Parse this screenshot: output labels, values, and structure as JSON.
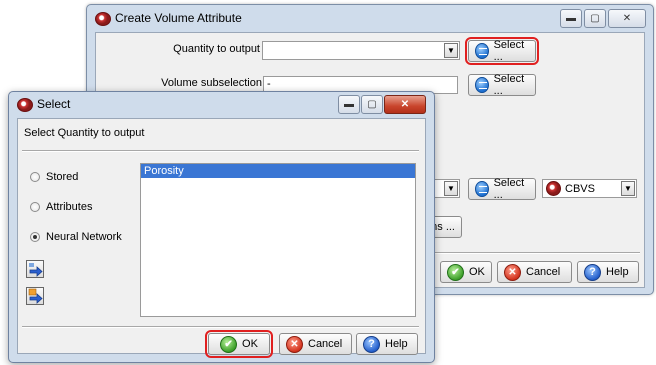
{
  "back_window": {
    "title": "Create Volume Attribute",
    "quantity_label": "Quantity to output",
    "quantity_value": "",
    "select_label": "Select ...",
    "subselection_label": "Volume subselection",
    "subselection_value": "-",
    "select2_label": "Select ...",
    "select3_label": "Select ...",
    "cbvs_label": "CBVS",
    "options_label": "ons ...",
    "ok_label": "OK",
    "cancel_label": "Cancel",
    "help_label": "Help"
  },
  "front_window": {
    "title": "Select",
    "heading": "Select Quantity to output",
    "radio_stored": "Stored",
    "radio_attributes": "Attributes",
    "radio_neural": "Neural Network",
    "selected_radio": "Neural Network",
    "list_items": [
      "Porosity"
    ],
    "ok_label": "OK",
    "cancel_label": "Cancel",
    "help_label": "Help"
  },
  "icons": {
    "app": "cube-app-icon",
    "select": "database-icon",
    "ok": "check-icon",
    "cancel": "x-icon",
    "help": "question-icon"
  }
}
